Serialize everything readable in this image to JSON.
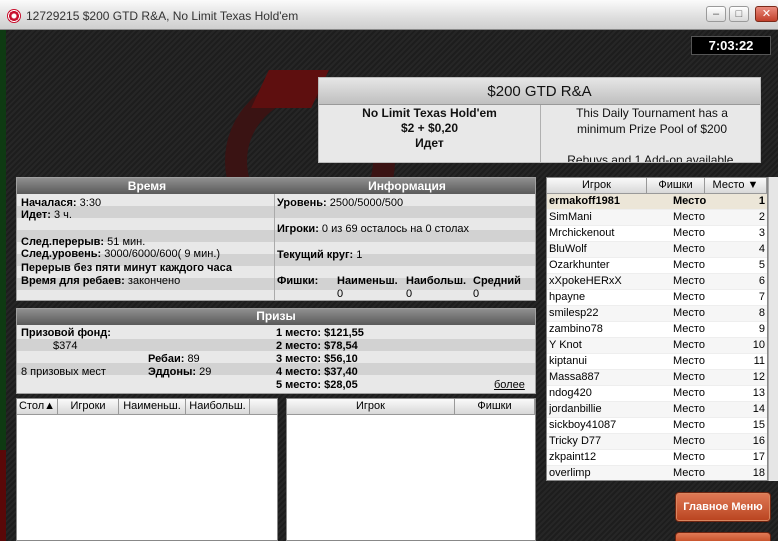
{
  "window": {
    "title": "12729215 $200 GTD R&A, No Limit Texas Hold'em"
  },
  "clock": "7:03:22",
  "header": {
    "name": "$200 GTD R&A",
    "game": "No Limit Texas Hold'em",
    "buyin": "$2 + $0,20",
    "status": "Идет",
    "desc_line1": "This Daily Tournament has a",
    "desc_line2": "minimum Prize Pool of $200",
    "desc_line3": "Rebuys and 1 Add-on available."
  },
  "time": {
    "heading": "Время",
    "started_label": "Началася:",
    "started_value": "3:30",
    "running_label": "Идет:",
    "running_value": "3 ч.",
    "next_break_label": "След.перерыв:",
    "next_break_value": "51 мин.",
    "next_level_label": "След.уровень:",
    "next_level_value": "3000/6000/600( 9 мин.)",
    "break_note": "Перерыв без пяти минут каждого часа",
    "rebuy_label": "Время для ребаев:",
    "rebuy_value": "закончено"
  },
  "info": {
    "heading": "Информация",
    "level_label": "Уровень:",
    "level_value": "2500/5000/500",
    "players_label": "Игроки:",
    "players_value": "0 из 69 осталось на 0 столах",
    "round_label": "Текущий круг:",
    "round_value": "1",
    "chips_label": "Фишки:",
    "min_label": "Наименьш.",
    "min_value": "0",
    "max_label": "Наибольш.",
    "max_value": "0",
    "avg_label": "Средний",
    "avg_value": "0"
  },
  "prizes": {
    "heading": "Призы",
    "pool_label": "Призовой фонд:",
    "pool_value": "$374",
    "rebuys_label": "Ребаи:",
    "rebuys_value": "89",
    "addons_label": "Эддоны:",
    "addons_value": "29",
    "paid_places": "8 призовых мест",
    "places": [
      {
        "label": "1 место:",
        "value": "$121,55"
      },
      {
        "label": "2 место:",
        "value": "$78,54"
      },
      {
        "label": "3 место:",
        "value": "$56,10"
      },
      {
        "label": "4 место:",
        "value": "$37,40"
      },
      {
        "label": "5 место:",
        "value": "$28,05"
      }
    ],
    "more": "более"
  },
  "tables_list": {
    "col_table": "Стол",
    "col_players": "Игроки",
    "col_min": "Наименьш.",
    "col_max": "Наибольш."
  },
  "players_list": {
    "col_player": "Игрок",
    "col_chips": "Фишки"
  },
  "leaderboard": {
    "col_player": "Игрок",
    "col_chips": "Фишки",
    "col_place": "Место",
    "rows": [
      {
        "name": "ermakoff1981",
        "chips": "Место",
        "place": "1"
      },
      {
        "name": "SimMani",
        "chips": "Место",
        "place": "2"
      },
      {
        "name": "Mrchickenout",
        "chips": "Место",
        "place": "3"
      },
      {
        "name": "BluWolf",
        "chips": "Место",
        "place": "4"
      },
      {
        "name": "Ozarkhunter",
        "chips": "Место",
        "place": "5"
      },
      {
        "name": "xXpokeHERxX",
        "chips": "Место",
        "place": "6"
      },
      {
        "name": "hpayne",
        "chips": "Место",
        "place": "7"
      },
      {
        "name": "smilesp22",
        "chips": "Место",
        "place": "8"
      },
      {
        "name": "zambino78",
        "chips": "Место",
        "place": "9"
      },
      {
        "name": "Y Knot",
        "chips": "Место",
        "place": "10"
      },
      {
        "name": "kiptanui",
        "chips": "Место",
        "place": "11"
      },
      {
        "name": "Massa887",
        "chips": "Место",
        "place": "12"
      },
      {
        "name": "ndog420",
        "chips": "Место",
        "place": "13"
      },
      {
        "name": "jordanbillie",
        "chips": "Место",
        "place": "14"
      },
      {
        "name": "sickboy41087",
        "chips": "Место",
        "place": "15"
      },
      {
        "name": "Tricky D77",
        "chips": "Место",
        "place": "16"
      },
      {
        "name": "zkpaint12",
        "chips": "Место",
        "place": "17"
      },
      {
        "name": "overlimp",
        "chips": "Место",
        "place": "18"
      }
    ]
  },
  "buttons": {
    "main_menu": "Главное Меню"
  },
  "icons": {
    "sort": "sort-arrow-icon",
    "close": "close-icon",
    "minimize": "minimize-icon",
    "maximize": "maximize-icon"
  }
}
